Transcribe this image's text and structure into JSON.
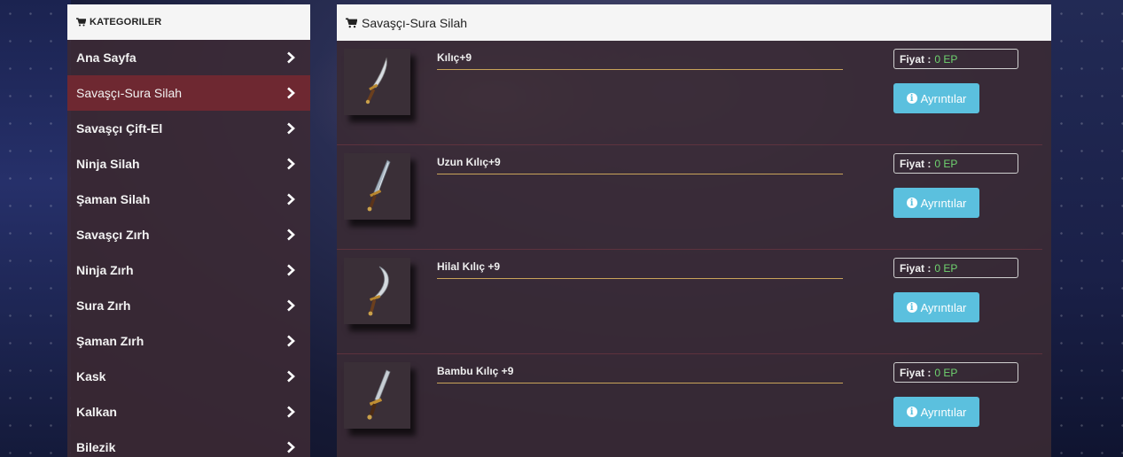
{
  "sidebar": {
    "header": "KATEGORILER",
    "items": [
      {
        "label": "Ana Sayfa"
      },
      {
        "label": "Savaşçı-Sura Silah"
      },
      {
        "label": "Savaşçı Çift-El"
      },
      {
        "label": "Ninja Silah"
      },
      {
        "label": "Şaman Silah"
      },
      {
        "label": "Savaşçı Zırh"
      },
      {
        "label": "Ninja Zırh"
      },
      {
        "label": "Sura Zırh"
      },
      {
        "label": "Şaman Zırh"
      },
      {
        "label": "Kask"
      },
      {
        "label": "Kalkan"
      },
      {
        "label": "Bilezik"
      }
    ]
  },
  "main": {
    "title": "Savaşçı-Sura Silah",
    "price_label": "Fiyat :",
    "details_label": "Ayrıntılar",
    "products": [
      {
        "name": "Kılıç+9",
        "price": "0 EP",
        "icon": "short-sword-icon"
      },
      {
        "name": "Uzun Kılıç+9",
        "price": "0 EP",
        "icon": "long-sword-icon"
      },
      {
        "name": "Hilal Kılıç +9",
        "price": "0 EP",
        "icon": "crescent-sword-icon"
      },
      {
        "name": "Bambu Kılıç +9",
        "price": "0 EP",
        "icon": "bamboo-sword-icon"
      }
    ]
  },
  "colors": {
    "accent_button": "#5bc0de",
    "price_value": "#6fd36f",
    "active_item": "#782830"
  }
}
